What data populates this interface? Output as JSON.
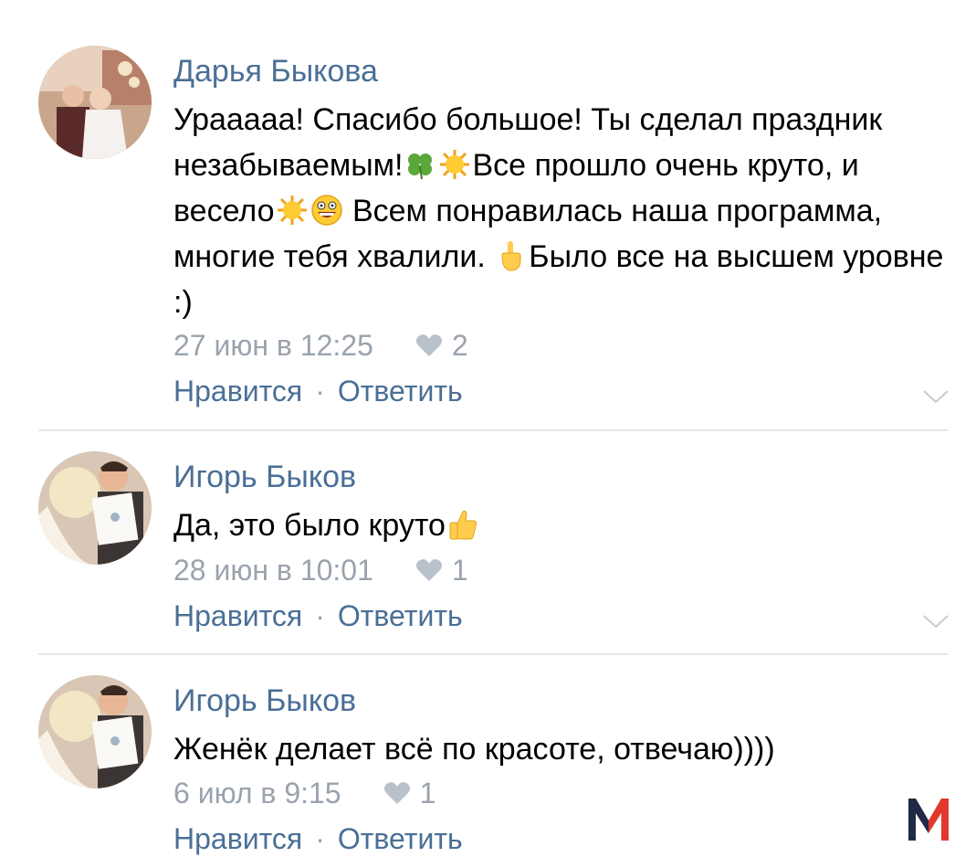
{
  "comments": [
    {
      "author": "Дарья Быкова",
      "text_parts": [
        "Урааааа! Спасибо большое! Ты сделал праздник незабываемым!",
        "Все прошло очень круто, и весело",
        "Всем понравилась наша программа, многие тебя хвалили. ",
        "Было все на высшем уровне :)"
      ],
      "date": "27 июн в 12:25",
      "likes": "2",
      "like_label": "Нравится",
      "reply_label": "Ответить",
      "separator": "·"
    },
    {
      "author": "Игорь Быков",
      "text_parts": [
        "Да, это было круто"
      ],
      "date": "28 июн в 10:01",
      "likes": "1",
      "like_label": "Нравится",
      "reply_label": "Ответить",
      "separator": "·"
    },
    {
      "author": "Игорь Быков",
      "text_parts": [
        "Женёк делает всё по красоте, отвечаю))))"
      ],
      "date": "6 июл в 9:15",
      "likes": "1",
      "like_label": "Нравится",
      "reply_label": "Ответить",
      "separator": "·"
    }
  ],
  "colors": {
    "link": "#4a6f96",
    "meta": "#9aa3ad",
    "divider": "#e3e6ea",
    "logo": "#e03a2f"
  },
  "icons": [
    "clover-emoji",
    "sun-emoji",
    "grinning-emoji",
    "pointing-down-emoji",
    "thumbs-up-emoji",
    "heart-icon",
    "chevron-down-icon"
  ]
}
